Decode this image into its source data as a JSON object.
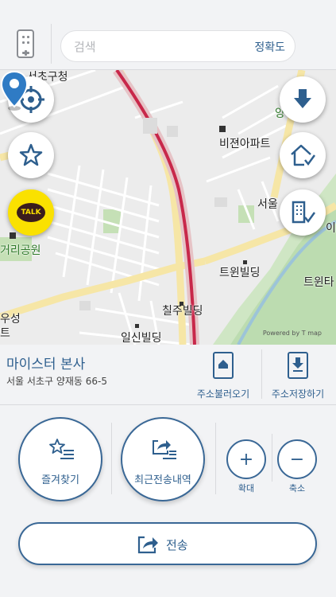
{
  "search": {
    "placeholder": "검색",
    "accuracy_label": "정확도"
  },
  "map": {
    "labels": {
      "seocho_office": "서초구청",
      "vision_apt": "비젼아파트",
      "seoul": "서울",
      "park": "거리공원",
      "twin_building": "트윈빌딩",
      "twin_right": "트윈타",
      "chiljoo": "칠주빌딩",
      "ilsin": "일신빌딩",
      "left_edge_1": "우성",
      "left_edge_2": "트",
      "right_edge_top": "이",
      "right_edge_green": "양"
    },
    "kakao_label": "TALK",
    "credit": "Powered by T map"
  },
  "address": {
    "name": "마이스터 본사",
    "detail": "서울 서초구 양재동  66-5",
    "load_label": "주소불러오기",
    "save_label": "주소저장하기"
  },
  "controls": {
    "favorites_label": "즐겨찾기",
    "recent_label": "최근전송내역",
    "zoom_in_symbol": "+",
    "zoom_out_symbol": "−",
    "zoom_in_label": "확대",
    "zoom_out_label": "축소",
    "send_label": "전송"
  },
  "colors": {
    "accent": "#2e5f8e",
    "pin": "#2f7bc4",
    "kakao": "#fae100"
  }
}
